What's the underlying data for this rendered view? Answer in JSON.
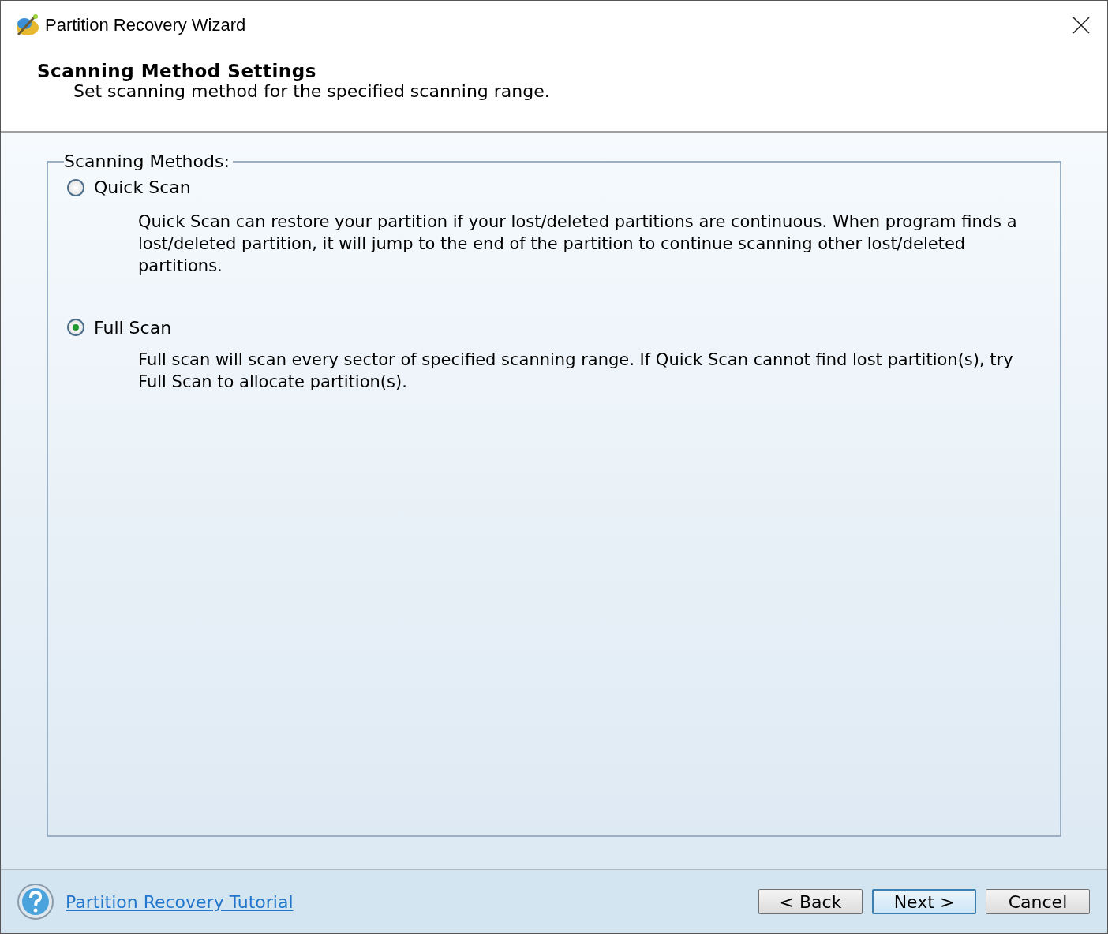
{
  "window": {
    "title": "Partition Recovery Wizard"
  },
  "header": {
    "title": "Scanning Method Settings",
    "subtitle": "Set scanning method for the specified scanning range."
  },
  "group": {
    "label": "Scanning Methods:",
    "options": [
      {
        "label": "Quick Scan",
        "selected": false,
        "description": "Quick Scan can restore your partition if your lost/deleted partitions are continuous. When program finds a lost/deleted partition, it will jump to the end of the partition to continue scanning other lost/deleted partitions."
      },
      {
        "label": "Full Scan",
        "selected": true,
        "description": "Full scan will scan every sector of specified scanning range. If Quick Scan cannot find lost partition(s), try Full Scan to allocate partition(s)."
      }
    ]
  },
  "footer": {
    "link": "Partition Recovery Tutorial",
    "buttons": [
      {
        "label": "< Back",
        "default": false
      },
      {
        "label": "Next >",
        "default": true
      },
      {
        "label": "Cancel",
        "default": false
      }
    ]
  }
}
